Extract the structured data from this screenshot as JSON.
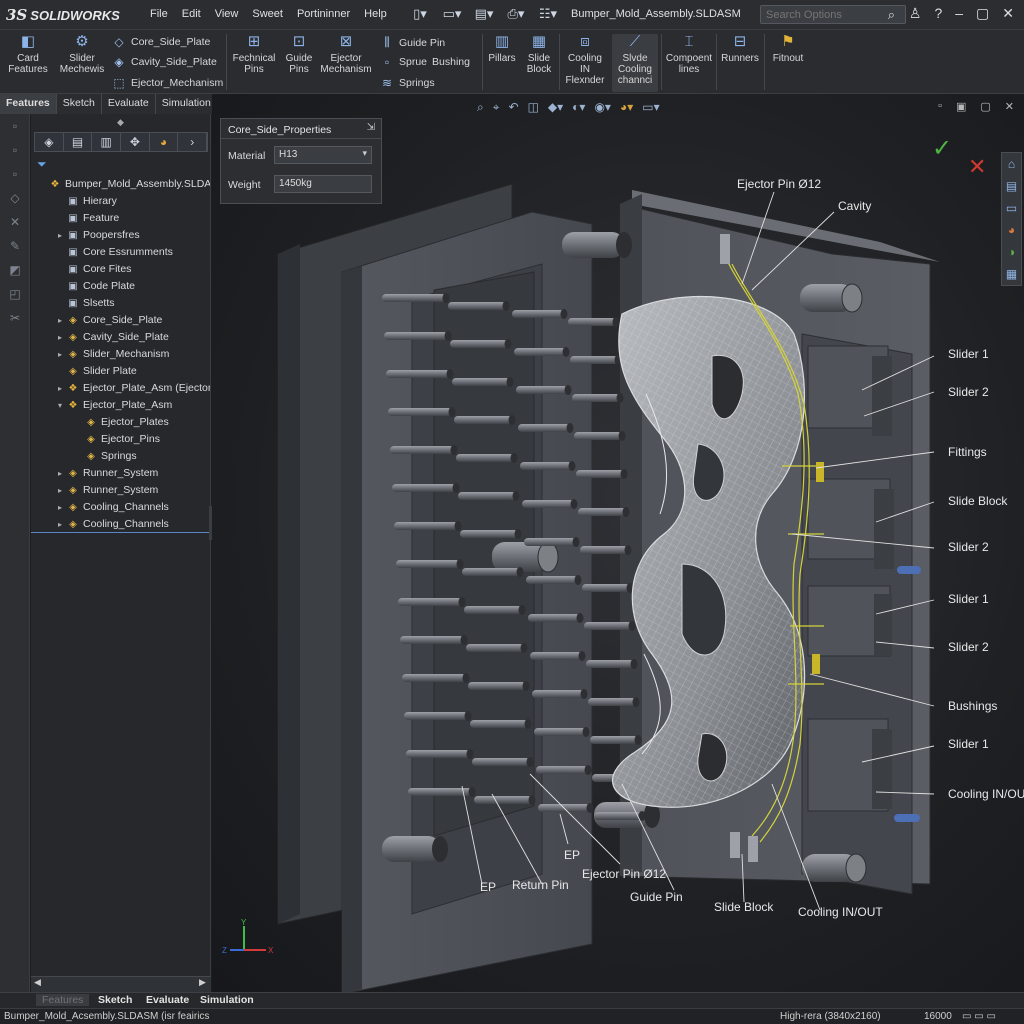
{
  "app": {
    "logo_ds": "3S",
    "logo_name": "SOLIDWORKS"
  },
  "menu": [
    "File",
    "Edit",
    "View",
    "Sweet",
    "Portininner",
    "Help"
  ],
  "document_title": "Bumper_Mold_Assembly.SLDASM",
  "search": {
    "placeholder": "Search Options"
  },
  "ribbon": {
    "card_features": "Card Features",
    "slider_mechanism": "Slider Mechewis",
    "small_items": [
      "Core_Side_Plate",
      "Cavity_Side_Plate",
      "Ejector_Mechanism"
    ],
    "technical_pins": "Fechnical Pins",
    "guide_pins": "Guide Pins",
    "ejector_mechanism": "Ejector Mechanism",
    "small_items_2": [
      "Guide Pin",
      "Sprue",
      "Bushing",
      "Springs"
    ],
    "pillars": "Pillars",
    "slide_block": "Slide Block",
    "cooling_in": "Cooling IN Flexnder",
    "slide_cooling": "Slvde Cooling channci",
    "component_lines": "Compoent lines",
    "runners": "Runners",
    "fitout": "Fitnout"
  },
  "command_tabs": [
    "Features",
    "Sketch",
    "Evaluate",
    "Simulation"
  ],
  "tree": {
    "items": [
      {
        "label": "Bumper_Mold_Assembly.SLDASM",
        "indent": 0,
        "arrow": "",
        "icon": "assembly-icon"
      },
      {
        "label": "Hierary",
        "indent": 1,
        "arrow": "",
        "icon": "folder-icon"
      },
      {
        "label": "Feature",
        "indent": 1,
        "arrow": "",
        "icon": "folder-icon"
      },
      {
        "label": "Poopersfres",
        "indent": 1,
        "arrow": "▸",
        "icon": "folder-icon"
      },
      {
        "label": "Core Essrumments",
        "indent": 1,
        "arrow": "",
        "icon": "folder-icon"
      },
      {
        "label": "Core Fites",
        "indent": 1,
        "arrow": "",
        "icon": "folder-icon"
      },
      {
        "label": "Code Plate",
        "indent": 1,
        "arrow": "",
        "icon": "folder-icon"
      },
      {
        "label": "Slsetts",
        "indent": 1,
        "arrow": "",
        "icon": "folder-icon"
      },
      {
        "label": "Core_Side_Plate",
        "indent": 1,
        "arrow": "▸",
        "icon": "part-icon"
      },
      {
        "label": "Cavity_Side_Plate",
        "indent": 1,
        "arrow": "▸",
        "icon": "part-icon"
      },
      {
        "label": "Slider_Mechanism",
        "indent": 1,
        "arrow": "▸",
        "icon": "part-icon"
      },
      {
        "label": "Slider Plate",
        "indent": 1,
        "arrow": "",
        "icon": "part-icon"
      },
      {
        "label": "Ejector_Plate_Asm (Ejector_Pla",
        "indent": 1,
        "arrow": "▸",
        "icon": "assembly-icon"
      },
      {
        "label": "Ejector_Plate_Asm",
        "indent": 1,
        "arrow": "▾",
        "icon": "assembly-icon"
      },
      {
        "label": "Ejector_Plates",
        "indent": 2,
        "arrow": "",
        "icon": "part-icon"
      },
      {
        "label": "Ejector_Pins",
        "indent": 2,
        "arrow": "",
        "icon": "part-icon"
      },
      {
        "label": "Springs",
        "indent": 2,
        "arrow": "",
        "icon": "part-icon"
      },
      {
        "label": "Runner_System",
        "indent": 1,
        "arrow": "▸",
        "icon": "part-icon"
      },
      {
        "label": "Runner_System",
        "indent": 1,
        "arrow": "▸",
        "icon": "part-icon"
      },
      {
        "label": "Cooling_Channels",
        "indent": 1,
        "arrow": "▸",
        "icon": "part-icon"
      },
      {
        "label": "Cooling_Channels",
        "indent": 1,
        "arrow": "▸",
        "icon": "part-icon"
      }
    ]
  },
  "properties": {
    "title": "Core_Side_Properties",
    "material_label": "Material",
    "material_value": "H13",
    "weight_label": "Weight",
    "weight_value": "1450kg"
  },
  "callouts": {
    "ejector_pin_top": "Ejector Pin Ø12",
    "cavity": "Cavity",
    "right": [
      "Slider 1",
      "Slider 2",
      "Fittings",
      "Slide Block",
      "Slider 2",
      "Slider 1",
      "Slider 2",
      "Bushings",
      "Slider 1",
      "Cooling IN/OUT"
    ],
    "bottom": [
      "EP",
      "Return Pin",
      "EP",
      "Ejector Pin Ø12",
      "Guide Pin",
      "Slide Block",
      "Cooling IN/OUT"
    ]
  },
  "triad": {
    "y": "Y",
    "z": "Z",
    "x": "X"
  },
  "bottom_tabs": [
    "Features",
    "Sketch",
    "Evaluate",
    "Simulation"
  ],
  "status": {
    "left": "Bumper_Mold_Acsembly.SLDASM (isr feairics",
    "resolution": "High-rera (3840x2160)",
    "value": "16000"
  },
  "colors": {
    "accent_blue": "#8db4e8",
    "accept_green": "#4eb542",
    "reject_red": "#d0392f",
    "callout_yellow": "#d4d23a"
  }
}
